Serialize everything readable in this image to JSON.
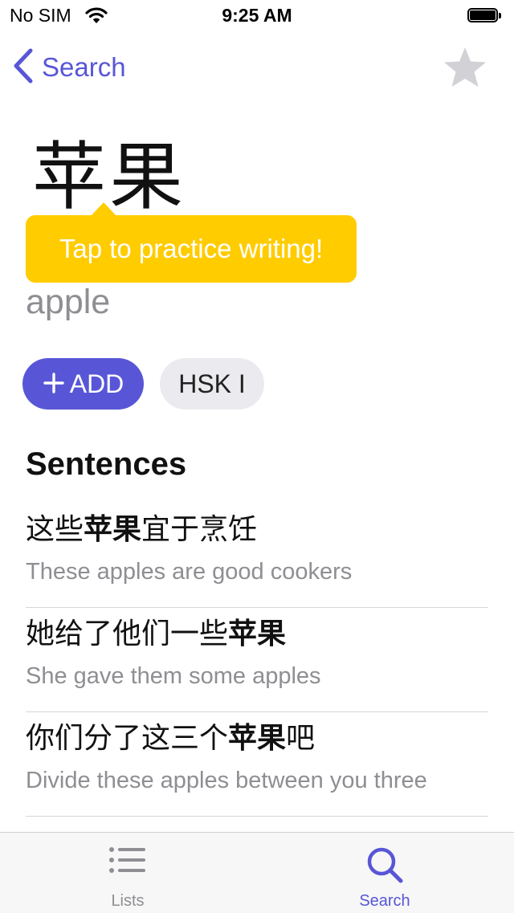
{
  "status_bar": {
    "carrier": "No SIM",
    "time": "9:25 AM"
  },
  "nav": {
    "back_label": "Search"
  },
  "word": {
    "hanzi": "苹果",
    "meaning": "apple",
    "tooltip": "Tap to practice writing!",
    "add_label": "ADD",
    "hsk_label": "HSK I"
  },
  "sentences_title": "Sentences",
  "sentences": [
    {
      "zh_before": "这些",
      "zh_bold": "苹果",
      "zh_after": "宜于烹饪",
      "en": "These apples are good cookers"
    },
    {
      "zh_before": "她给了他们一些",
      "zh_bold": "苹果",
      "zh_after": "",
      "en": "She gave them some apples"
    },
    {
      "zh_before": "你们分了这三个",
      "zh_bold": "苹果",
      "zh_after": "吧",
      "en": "Divide these apples between you three"
    }
  ],
  "tabs": [
    {
      "label": "Lists",
      "icon": "list-icon"
    },
    {
      "label": "Search",
      "icon": "search-icon"
    }
  ],
  "colors": {
    "accent": "#5856d6",
    "tooltip": "#ffcc00",
    "secondary_text": "#8e8e93",
    "pill_gray": "#ebebef"
  }
}
